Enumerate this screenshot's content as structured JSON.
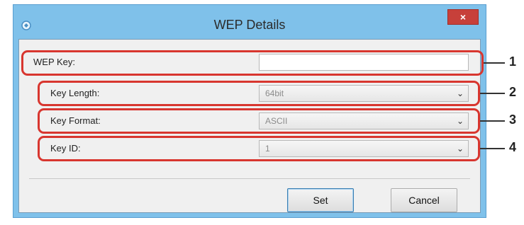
{
  "window": {
    "title": "WEP Details",
    "close_glyph": "×"
  },
  "fields": {
    "wep_key": {
      "label": "WEP Key:",
      "value": ""
    },
    "key_length": {
      "label": "Key Length:",
      "value": "64bit"
    },
    "key_format": {
      "label": "Key Format:",
      "value": "ASCII"
    },
    "key_id": {
      "label": "Key ID:",
      "value": "1"
    }
  },
  "buttons": {
    "set": "Set",
    "cancel": "Cancel"
  },
  "callouts": [
    "1",
    "2",
    "3",
    "4"
  ],
  "colors": {
    "highlight": "#d8362f",
    "title_bar": "#7fc1ea",
    "close": "#c7403a"
  },
  "icons": {
    "app": "app-icon",
    "close": "close-icon",
    "dropdown": "chevron-down-icon"
  }
}
